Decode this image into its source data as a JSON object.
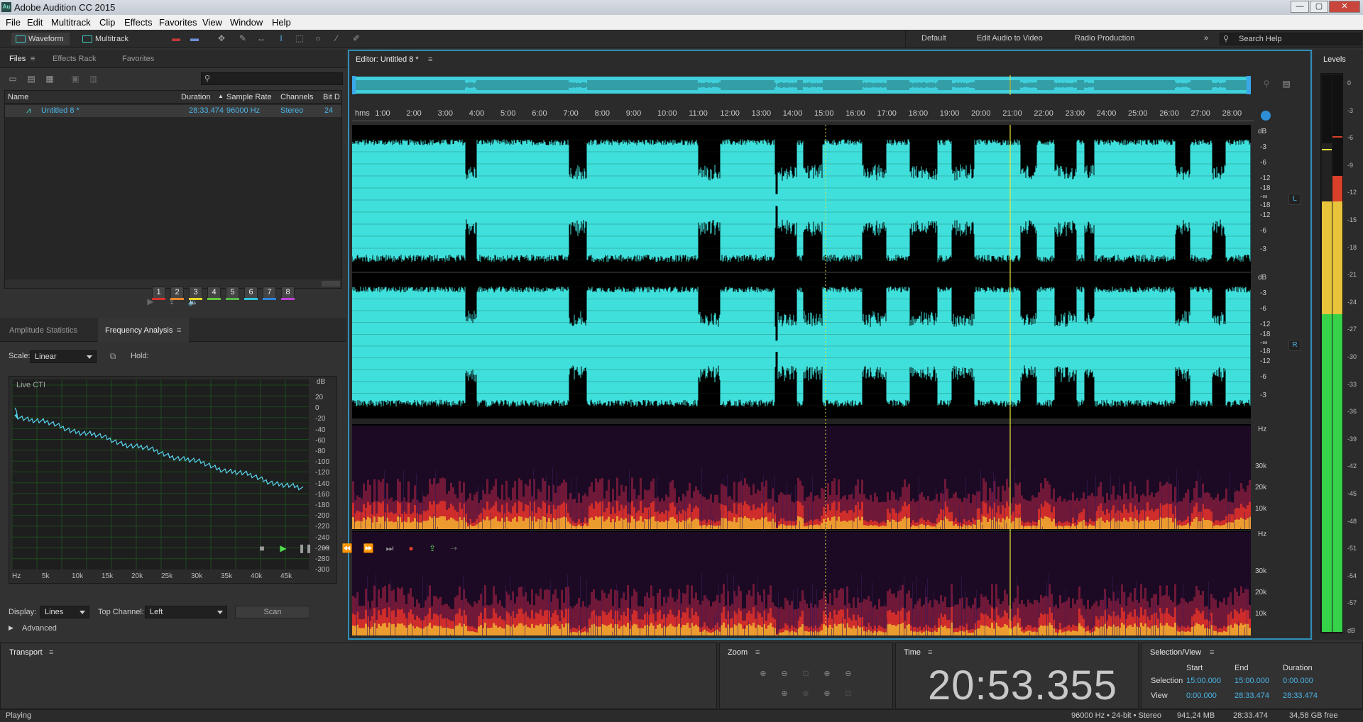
{
  "window": {
    "title": "Adobe Audition CC 2015",
    "icon_text": "Au"
  },
  "window_controls": {
    "minimize": "—",
    "maximize": "▢",
    "close": "✕"
  },
  "menu": [
    "File",
    "Edit",
    "Multitrack",
    "Clip",
    "Effects",
    "Favorites",
    "View",
    "Window",
    "Help"
  ],
  "toolbar": {
    "views": [
      {
        "label": "Waveform",
        "active": true
      },
      {
        "label": "Multitrack",
        "active": false
      }
    ],
    "workspaces": [
      "Default",
      "Edit Audio to Video",
      "Radio Production"
    ],
    "more": "»",
    "search_placeholder": "Search Help"
  },
  "files_panel": {
    "tabs": [
      "Files",
      "Effects Rack",
      "Favorites"
    ],
    "search_placeholder": "",
    "columns": [
      "Name",
      "Duration",
      "Sample Rate",
      "Channels",
      "Bit D"
    ],
    "rows": [
      {
        "name": "Untitled 8 *",
        "duration": "28:33.474",
        "sample_rate": "96000 Hz",
        "channels": "Stereo",
        "bit_depth": "24"
      }
    ]
  },
  "freq_panel": {
    "tabs": [
      "Amplitude Statistics",
      "Frequency Analysis"
    ],
    "scale_label": "Scale:",
    "scale_value": "Linear",
    "hold_label": "Hold:",
    "hold_buttons": [
      "1",
      "2",
      "3",
      "4",
      "5",
      "6",
      "7",
      "8"
    ],
    "hold_colors": [
      "#d9302c",
      "#e8862a",
      "#e6d528",
      "#62c43a",
      "#56b848",
      "#2fc4d8",
      "#2c84d8",
      "#c040d8"
    ],
    "graph_label": "Live CTI",
    "y_unit": "dB",
    "y_ticks": [
      "20",
      "0",
      "-20",
      "-40",
      "-60",
      "-80",
      "-100",
      "-120",
      "-140",
      "-160",
      "-180",
      "-200",
      "-220",
      "-240",
      "-260",
      "-280",
      "-300"
    ],
    "x_ticks": [
      "Hz",
      "5k",
      "10k",
      "15k",
      "20k",
      "25k",
      "30k",
      "35k",
      "40k",
      "45k"
    ],
    "display_label": "Display:",
    "display_value": "Lines",
    "top_channel_label": "Top Channel:",
    "top_channel_value": "Left",
    "scan_label": "Scan",
    "advanced_label": "Advanced"
  },
  "editor": {
    "title": "Editor: Untitled 8 *",
    "ruler": [
      "hms",
      "1:00",
      "2:00",
      "3:00",
      "4:00",
      "5:00",
      "6:00",
      "7:00",
      "8:00",
      "9:00",
      "10:00",
      "11:00",
      "12:00",
      "13:00",
      "14:00",
      "15:00",
      "16:00",
      "17:00",
      "18:00",
      "19:00",
      "20:00",
      "21:00",
      "22:00",
      "23:00",
      "24:00",
      "25:00",
      "26:00",
      "27:00",
      "28:00"
    ],
    "db_scale": [
      "dB",
      "-3",
      "-6",
      "-12",
      "-18",
      "-∞",
      "-18",
      "-12",
      "-6",
      "-3"
    ],
    "spec_scale": [
      "Hz",
      "30k",
      "20k",
      "10k"
    ],
    "channel_left": "L",
    "channel_right": "R",
    "waveform_color": "#3fe0dc",
    "playhead_color": "#e8e63a"
  },
  "levels": {
    "title": "Levels",
    "scale": [
      "0",
      "-3",
      "-6",
      "-9",
      "-12",
      "-15",
      "-18",
      "-21",
      "-24",
      "-27",
      "-30",
      "-33",
      "-36",
      "-39",
      "-42",
      "-45",
      "-48",
      "-51",
      "-54",
      "-57",
      "dB"
    ]
  },
  "transport": {
    "title": "Transport"
  },
  "zoom": {
    "title": "Zoom"
  },
  "time": {
    "title": "Time",
    "value": "20:53.355"
  },
  "selection_view": {
    "title": "Selection/View",
    "headers": [
      "Start",
      "End",
      "Duration"
    ],
    "rows": [
      {
        "label": "Selection",
        "start": "15:00.000",
        "end": "15:00.000",
        "duration": "0:00.000"
      },
      {
        "label": "View",
        "start": "0:00.000",
        "end": "28:33.474",
        "duration": "28:33.474"
      }
    ]
  },
  "statusbar": {
    "state": "Playing",
    "format": "96000 Hz • 24-bit • Stereo",
    "size": "941,24 MB",
    "duration": "28:33.474",
    "free": "34,58 GB free"
  }
}
